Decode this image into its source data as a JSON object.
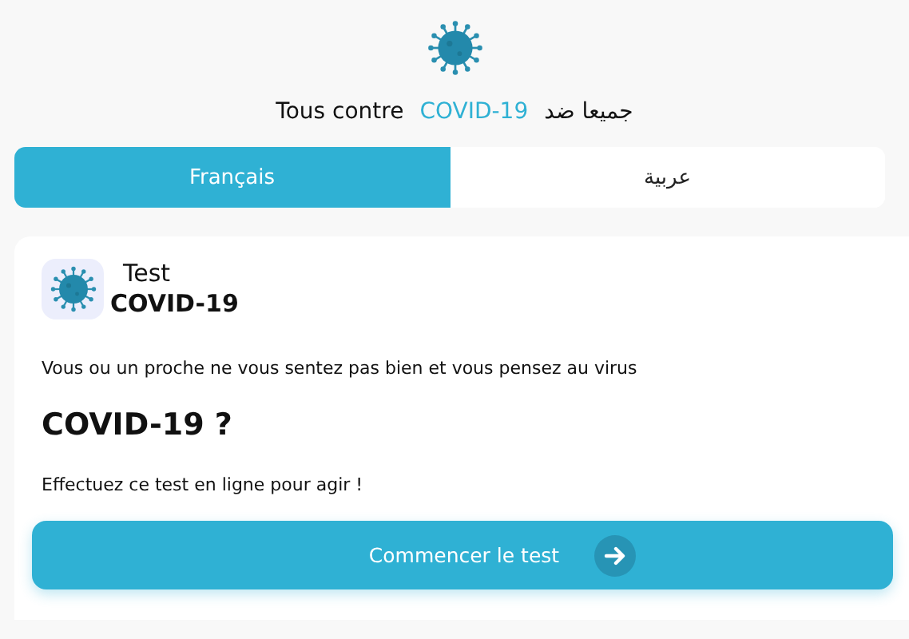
{
  "header": {
    "title_parts": [
      {
        "text": "Tous contre",
        "kind": "plain"
      },
      {
        "text": "COVID-19",
        "kind": "accent"
      },
      {
        "text": "جميعا ضد",
        "kind": "plain"
      }
    ]
  },
  "tabs": [
    {
      "label": "Français",
      "selected": true
    },
    {
      "label": "عربية",
      "selected": false
    }
  ],
  "card": {
    "title": "Test",
    "subtitle": "COVID-19",
    "intro": "Vous ou un proche ne vous sentez pas bien et vous pensez au virus",
    "heading": "COVID-19 ?",
    "prompt": "Effectuez ce test en ligne pour agir !",
    "button": "Commencer le test"
  }
}
